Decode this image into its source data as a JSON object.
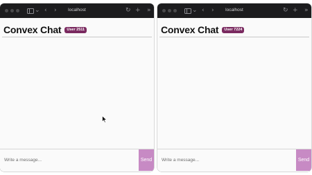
{
  "browser": {
    "url": "localhost",
    "icons": [
      "back-icon",
      "forward-icon",
      "sidebar-icon",
      "reload-icon",
      "new-tab-icon",
      "more-icon"
    ]
  },
  "app": {
    "title": "Convex Chat",
    "input_placeholder": "Write a message...",
    "send_label": "Send"
  },
  "windows": [
    {
      "user_badge": "User 2511"
    },
    {
      "user_badge": "User 7224"
    }
  ],
  "colors": {
    "badge": "#7a2a60",
    "send_button": "#c78ac4",
    "toolbar": "#1c1c1e"
  }
}
